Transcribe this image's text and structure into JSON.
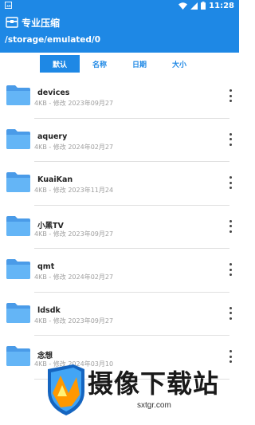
{
  "status_bar": {
    "time": "11:28"
  },
  "app": {
    "title": "专业压缩",
    "path": "/storage/emulated/0"
  },
  "sort_tabs": [
    {
      "label": "默认",
      "active": true
    },
    {
      "label": "名称",
      "active": false
    },
    {
      "label": "日期",
      "active": false
    },
    {
      "label": "大小",
      "active": false
    }
  ],
  "files": [
    {
      "name": "devices",
      "meta": "4KB - 修改 2023年09月27"
    },
    {
      "name": "aquery",
      "meta": "4KB - 修改 2024年02月27"
    },
    {
      "name": "KuaiKan",
      "meta": "4KB - 修改 2023年11月24"
    },
    {
      "name": "小黑TV",
      "meta": "4KB - 修改 2023年09月27"
    },
    {
      "name": "qmt",
      "meta": "4KB - 修改 2024年02月27"
    },
    {
      "name": "ldsdk",
      "meta": "4KB - 修改 2023年09月27"
    },
    {
      "name": "念想",
      "meta": "4KB - 修改 2024年03月10"
    }
  ],
  "watermark": {
    "text": "摄像下载站",
    "url": "sxtgr.com"
  },
  "colors": {
    "primary": "#1e88e5",
    "folder": "#5aa9f0"
  }
}
